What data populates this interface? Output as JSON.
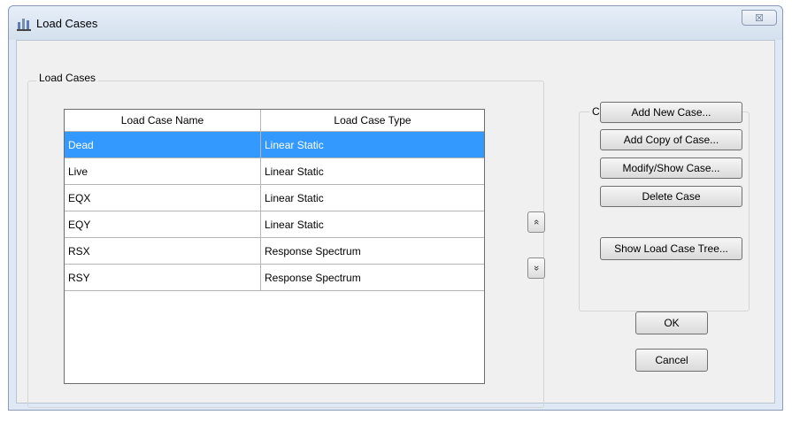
{
  "window": {
    "title": "Load Cases",
    "close_symbol": "☒"
  },
  "main_group": {
    "label": "Load Cases",
    "columns": [
      "Load Case Name",
      "Load Case Type"
    ],
    "rows": [
      {
        "name": "Dead",
        "type": "Linear Static",
        "selected": true
      },
      {
        "name": "Live",
        "type": "Linear Static",
        "selected": false
      },
      {
        "name": "EQX",
        "type": "Linear Static",
        "selected": false
      },
      {
        "name": "EQY",
        "type": "Linear Static",
        "selected": false
      },
      {
        "name": "RSX",
        "type": "Response Spectrum",
        "selected": false
      },
      {
        "name": "RSY",
        "type": "Response Spectrum",
        "selected": false
      }
    ]
  },
  "move_buttons": {
    "up_symbol": "«",
    "down_symbol": "»"
  },
  "click_group": {
    "label": "Click to:",
    "add_new": "Add New Case...",
    "add_copy": "Add Copy of Case...",
    "modify_show": "Modify/Show Case...",
    "delete": "Delete Case",
    "show_tree": "Show Load Case Tree..."
  },
  "dialog_buttons": {
    "ok": "OK",
    "cancel": "Cancel"
  },
  "colors": {
    "selection": "#3399ff"
  }
}
